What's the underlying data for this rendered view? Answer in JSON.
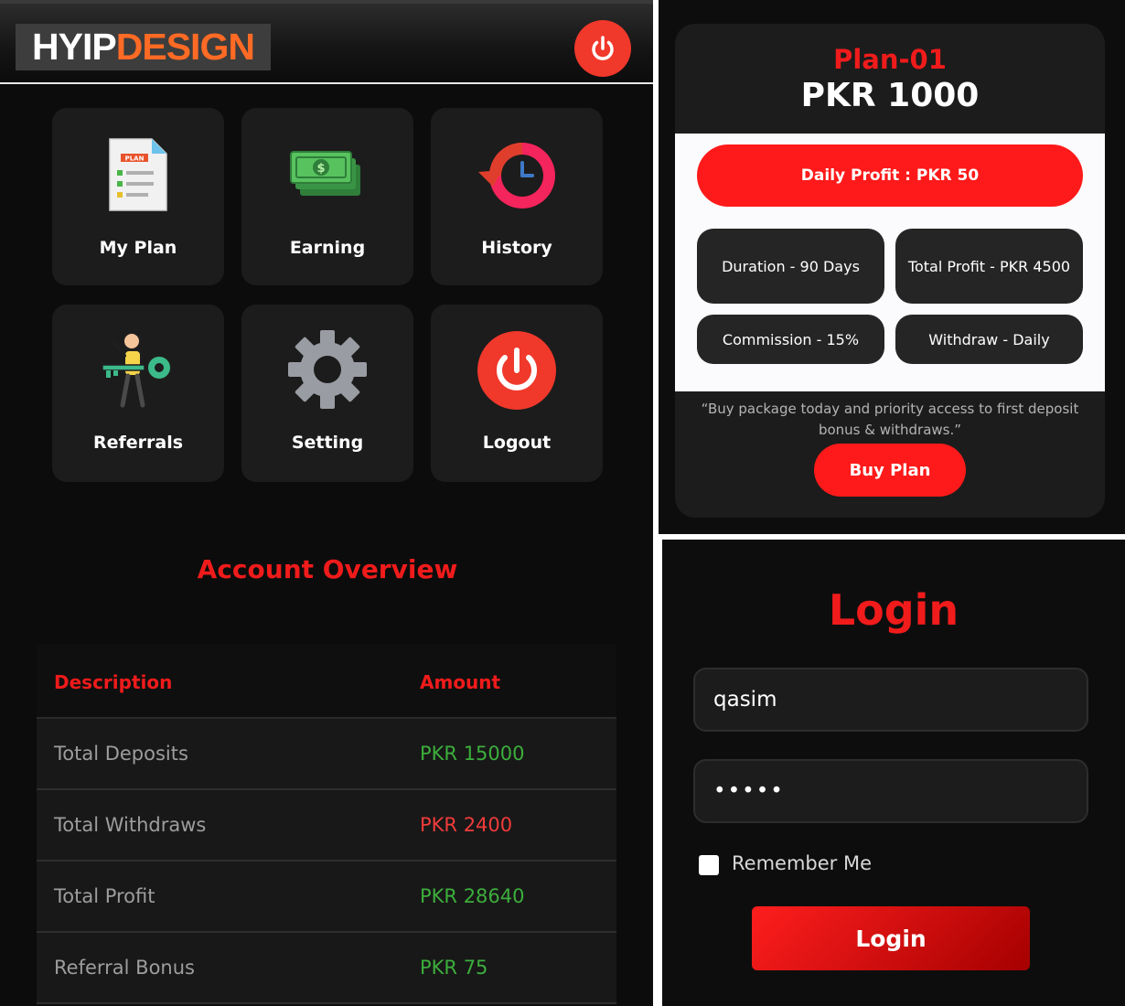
{
  "dashboard": {
    "logo": {
      "part1": "HYIP",
      "part2": "DESIGN"
    },
    "menu": [
      {
        "label": "My Plan",
        "icon": "plan-document-icon"
      },
      {
        "label": "Earning",
        "icon": "money-stack-icon"
      },
      {
        "label": "History",
        "icon": "history-clock-icon"
      },
      {
        "label": "Referrals",
        "icon": "person-key-icon"
      },
      {
        "label": "Setting",
        "icon": "gear-icon"
      },
      {
        "label": "Logout",
        "icon": "power-icon"
      }
    ],
    "overview_title": "Account Overview",
    "table": {
      "headers": {
        "description": "Description",
        "amount": "Amount"
      },
      "rows": [
        {
          "description": "Total Deposits",
          "amount": "PKR 15000",
          "color": "#3cae3c"
        },
        {
          "description": "Total Withdraws",
          "amount": "PKR 2400",
          "color": "#ef3b3b"
        },
        {
          "description": "Total Profit",
          "amount": "PKR 28640",
          "color": "#3cae3c"
        },
        {
          "description": "Referral Bonus",
          "amount": "PKR 75",
          "color": "#3cae3c"
        }
      ]
    }
  },
  "plan": {
    "name": "Plan-01",
    "price": "PKR 1000",
    "daily_profit": "Daily Profit : PKR 50",
    "chips": {
      "duration": "Duration - 90 Days",
      "total_profit": "Total Profit - PKR 4500",
      "commission": "Commission - 15%",
      "withdraw": "Withdraw - Daily"
    },
    "quote": "“Buy package today and priority access to first deposit bonus & withdraws.”",
    "buy_label": "Buy Plan"
  },
  "login": {
    "title": "Login",
    "username": "qasim",
    "password_mask": "•••••",
    "remember_label": "Remember Me",
    "button_label": "Login"
  },
  "colors": {
    "accent_red": "#f01b1b",
    "positive_green": "#3cae3c",
    "logo_orange": "#ff6a24"
  }
}
